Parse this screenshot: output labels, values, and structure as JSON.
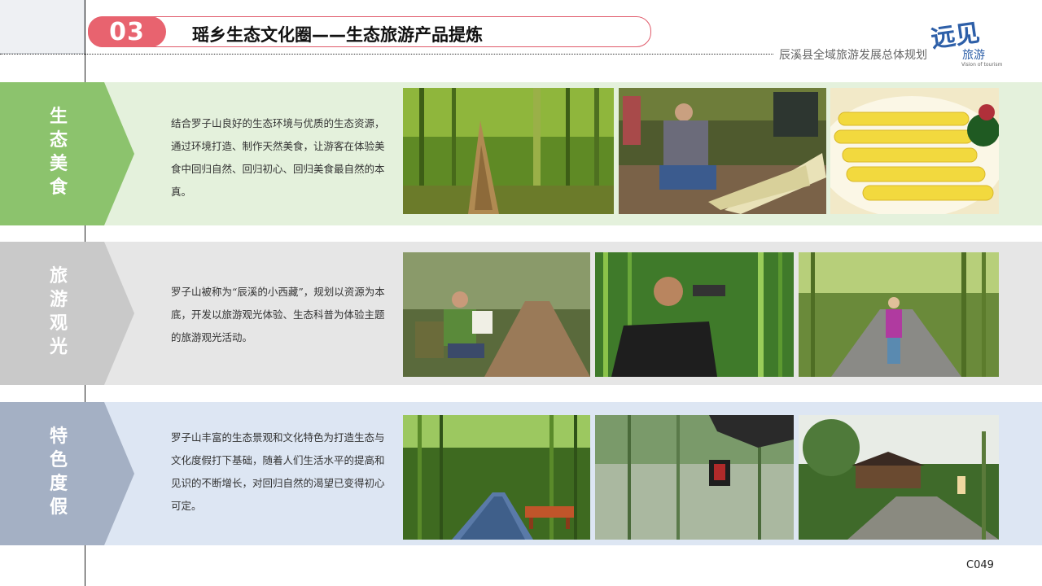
{
  "header": {
    "number": "03",
    "title": "瑶乡生态文化圈——生态旅游产品提炼",
    "plan_title": "辰溪县全域旅游发展总体规划",
    "logo_main": "远见",
    "logo_side": "旅游",
    "logo_sub": "Vision of tourism"
  },
  "sections": [
    {
      "tag": "生态美食",
      "description": "结合罗子山良好的生态环境与优质的生态资源，通过环境打造、制作天然美食，让游客在体验美食中回归自然、回归初心、回归美食最自然的本真。",
      "band_color": "#e4f1dc",
      "tag_color": "#8cc36d",
      "photos": [
        "bamboo-shoot-forest-photo",
        "villagers-peeling-shoots-photo",
        "sliced-shoots-dish-photo"
      ]
    },
    {
      "tag": "旅游观光",
      "description": "罗子山被称为“辰溪的小西藏”，规划以资源为本底，开发以旅游观光体验、生态科普为体验主题的旅游观光活动。",
      "band_color": "#e6e6e6",
      "tag_color": "#c9c9c9",
      "photos": [
        "hiker-reading-map-photo",
        "man-with-binoculars-photo",
        "girl-on-stone-path-photo"
      ]
    },
    {
      "tag": "特色度假",
      "description": "罗子山丰富的生态景观和文化特色为打造生态与文化度假打下基础，随着人们生活水平的提高和见识的不断增长，对回归自然的渴望已变得初心可定。",
      "band_color": "#dde6f3",
      "tag_color": "#a4b0c4",
      "photos": [
        "bamboo-path-bench-photo",
        "lantern-bamboo-courtyard-photo",
        "resort-garden-photo"
      ]
    }
  ],
  "page_number": "C049"
}
